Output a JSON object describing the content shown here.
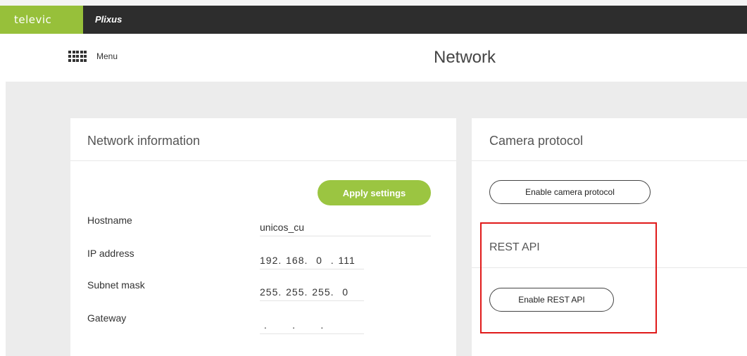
{
  "topbar": {
    "brand": "televic",
    "product": "Plixus"
  },
  "header": {
    "menu_label": "Menu",
    "page_title": "Network"
  },
  "network_card": {
    "title": "Network information",
    "apply_button": "Apply settings",
    "fields": [
      {
        "label": "Hostname",
        "value": "unicos_cu"
      },
      {
        "label": "IP address",
        "value": "192. 168.  0  . 111"
      },
      {
        "label": "Subnet mask",
        "value": "255. 255. 255.  0"
      },
      {
        "label": "Gateway",
        "value": " .      .      .  "
      }
    ]
  },
  "camera_card": {
    "title": "Camera protocol",
    "enable_button": "Enable camera protocol"
  },
  "rest_api": {
    "title": "REST API",
    "enable_button": "Enable REST API"
  },
  "colors": {
    "brand_green": "#97c03a",
    "topbar_dark": "#2d2d2d",
    "highlight_red": "#e01a1a"
  }
}
